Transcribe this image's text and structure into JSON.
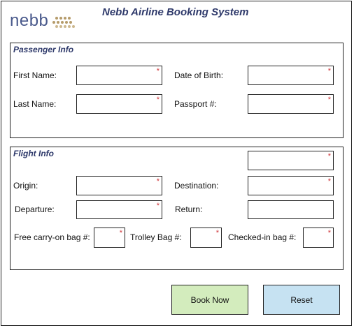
{
  "header": {
    "logo_text": "nebb",
    "title": "Nebb Airline Booking System"
  },
  "passenger": {
    "section_title": "Passenger Info",
    "first_name_label": "First Name:",
    "dob_label": "Date of Birth:",
    "last_name_label": "Last Name:",
    "passport_label": "Passport #:"
  },
  "flight": {
    "section_title": "Flight Info",
    "origin_label": "Origin:",
    "destination_label": "Destination:",
    "departure_label": "Departure:",
    "return_label": "Return:",
    "carry_on_label": "Free carry-on bag #:",
    "trolley_label": "Trolley Bag #:",
    "checked_label": "Checked-in bag #:"
  },
  "required_marker": "*",
  "actions": {
    "book_label": "Book Now",
    "reset_label": "Reset"
  },
  "colors": {
    "title": "#2f3a6b",
    "logo": "#4a5a8c",
    "required": "#d0363a",
    "book_button": "#d3ecbd",
    "reset_button": "#c6e2f2"
  }
}
